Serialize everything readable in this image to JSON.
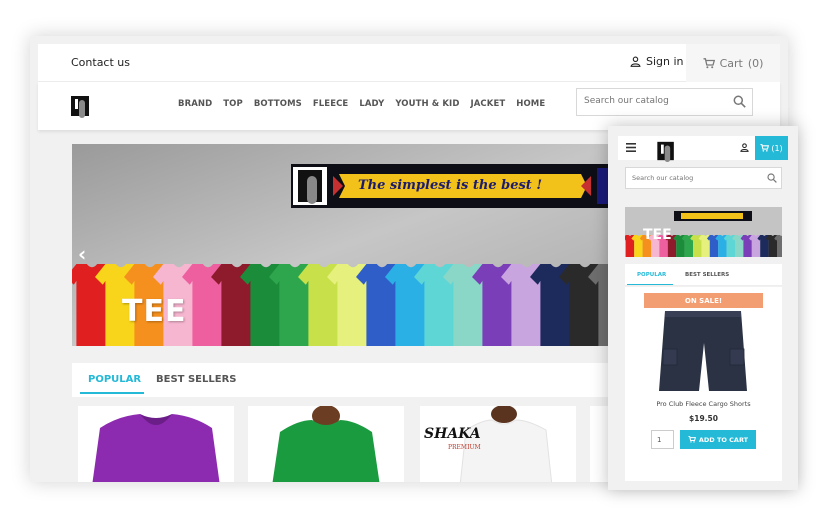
{
  "desktop": {
    "topbar": {
      "contact_label": "Contact us",
      "signin_label": "Sign in",
      "cart_label": "Cart",
      "cart_count": "(0)"
    },
    "nav": [
      "BRAND",
      "TOP",
      "BOTTOMS",
      "FLEECE",
      "LADY",
      "YOUTH & KID",
      "JACKET",
      "HOME"
    ],
    "search": {
      "placeholder": "Search our catalog"
    },
    "hero": {
      "banner_text": "The simplest is the best !",
      "overlay_text": "TEE",
      "prev_arrow": "‹"
    },
    "tabs": {
      "popular": "POPULAR",
      "best_sellers": "BEST SELLERS"
    },
    "products": [
      {
        "name": "purple-tee"
      },
      {
        "name": "green-tee"
      },
      {
        "name": "shaka-premium-tee",
        "brand_text": "SHAKA",
        "brand_sub": "PREMIUM"
      }
    ]
  },
  "mobile": {
    "cart_count": "(1)",
    "search": {
      "placeholder": "Search our catalog"
    },
    "hero": {
      "banner_text": "The simplest is the best !",
      "overlay_text": "TEE"
    },
    "tabs": {
      "popular": "POPULAR",
      "best_sellers": "BEST SELLERS"
    },
    "product": {
      "badge": "ON SALE!",
      "name": "Pro Club Fleece Cargo Shorts",
      "price": "$19.50",
      "quantity": "1",
      "add_label": "ADD TO CART"
    }
  },
  "colors": {
    "accent": "#24b9d7",
    "sale": "#f39d72",
    "text": "#232323",
    "tshirts": [
      "#e02020",
      "#f8d51a",
      "#f5901e",
      "#f7b6d0",
      "#ee5fa0",
      "#8e1b2b",
      "#1a8c3a",
      "#2ea64d",
      "#c8e04a",
      "#e6f07d",
      "#2f5ec8",
      "#2bb0e6",
      "#5fd6d6",
      "#8ad7c8",
      "#7a3fb8",
      "#c9a5e0",
      "#1d2a5c",
      "#2a2a2a",
      "#6e6e6e"
    ]
  },
  "icons": [
    "user-icon",
    "cart-icon",
    "search-icon",
    "hamburger-icon",
    "chevron-left-icon"
  ]
}
